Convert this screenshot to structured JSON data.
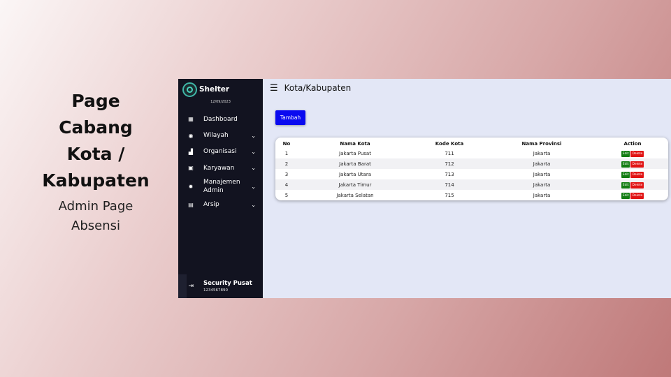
{
  "caption": {
    "title_lines": [
      "Page",
      "Cabang",
      "Kota /",
      "Kabupaten"
    ],
    "subtitle_lines": [
      "Admin Page",
      "Absensi"
    ]
  },
  "sidebar": {
    "brand": "Shelter",
    "date": "12/09/2023",
    "items": [
      {
        "label": "Dashboard",
        "icon": "grid-icon",
        "glyph": "▦",
        "has_chevron": false
      },
      {
        "label": "Wilayah",
        "icon": "globe-icon",
        "glyph": "◉",
        "has_chevron": true
      },
      {
        "label": "Organisasi",
        "icon": "building-icon",
        "glyph": "▟",
        "has_chevron": true
      },
      {
        "label": "Karyawan",
        "icon": "id-card-icon",
        "glyph": "▣",
        "has_chevron": true
      },
      {
        "label": "Manajemen Admin",
        "icon": "gear-icon",
        "glyph": "✹",
        "has_chevron": true
      },
      {
        "label": "Arsip",
        "icon": "file-icon",
        "glyph": "▤",
        "has_chevron": true
      }
    ],
    "chevron_glyph": "⌄",
    "profile": {
      "name": "Security Pusat",
      "id": "1234567890"
    },
    "logout_glyph": "⇥"
  },
  "header": {
    "menu_glyph": "☰",
    "title": "Kota/Kabupaten"
  },
  "actions": {
    "add_label": "Tambah"
  },
  "table": {
    "headers": [
      "No",
      "Nama Kota",
      "Kode Kota",
      "Nama Provinsi",
      "Action"
    ],
    "rows": [
      [
        "1",
        "Jakarta Pusat",
        "711",
        "Jakarta"
      ],
      [
        "2",
        "Jakarta Barat",
        "712",
        "Jakarta"
      ],
      [
        "3",
        "Jakarta Utara",
        "713",
        "Jakarta"
      ],
      [
        "4",
        "Jakarta Timur",
        "714",
        "Jakarta"
      ],
      [
        "5",
        "Jakarta Selatan",
        "715",
        "Jakarta"
      ]
    ],
    "edit_label": "Edit",
    "delete_label": "Delete"
  },
  "colors": {
    "sidebar_bg": "#121320",
    "main_bg": "#e3e7f6",
    "primary_button": "#0a0af0",
    "edit_button": "#137d13",
    "delete_button": "#e11414"
  }
}
